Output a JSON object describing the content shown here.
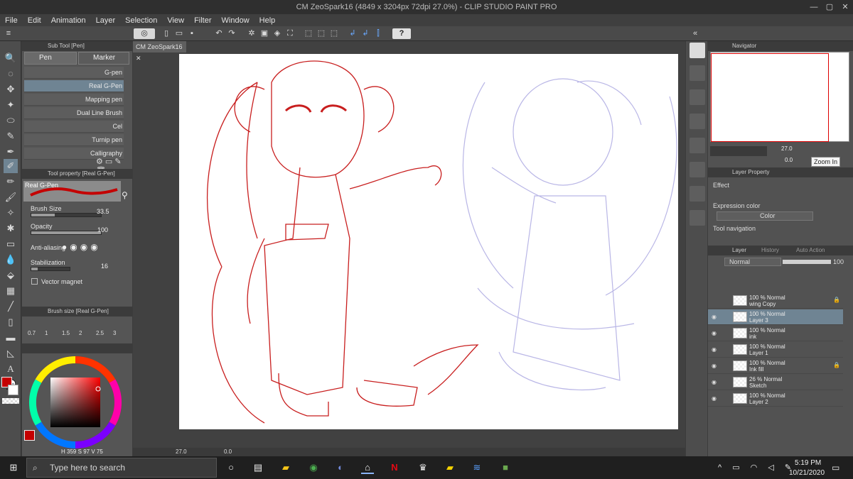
{
  "window": {
    "title": "CM ZeoSpark16 (4849 x 3204px 72dpi 27.0%) - CLIP STUDIO PAINT PRO",
    "min": "—",
    "max": "▢",
    "close": "✕"
  },
  "menu": [
    "File",
    "Edit",
    "Animation",
    "Layer",
    "Selection",
    "View",
    "Filter",
    "Window",
    "Help"
  ],
  "doc_tab": "CM ZeoSpark16",
  "subtool": {
    "header": "Sub Tool [Pen]",
    "tab_pen": "Pen",
    "tab_marker": "Marker",
    "brushes": [
      "G-pen",
      "Real G-Pen",
      "Mapping pen",
      "Dual Line Brush",
      "Cel",
      "Turnip pen",
      "Calligraphy"
    ],
    "selected_index": 1
  },
  "toolprop": {
    "header": "Tool property [Real G-Pen]",
    "brush_name": "Real G-Pen",
    "brush_size_label": "Brush Size",
    "brush_size": "33.5",
    "brush_size_level": 0.34,
    "opacity_label": "Opacity",
    "opacity": "100",
    "opacity_level": 1.0,
    "antialias_label": "Anti-aliasing",
    "stab_label": "Stabilization",
    "stab": "16",
    "stab_level": 0.16,
    "vector_label": "Vector magnet"
  },
  "brushsize": {
    "header": "Brush size [Real G-Pen]",
    "sizes": [
      "0.7",
      "1",
      "1.5",
      "2",
      "2.5",
      "3"
    ]
  },
  "color": {
    "main": "#c40000",
    "sub": "#ffffff",
    "h": "359",
    "s": "97",
    "v": "75",
    "h_label": "H",
    "s_label": "S",
    "v_label": "V"
  },
  "canvas_status": {
    "zoom": "27.0",
    "angle": "0.0"
  },
  "navigator": {
    "header": "Navigator",
    "zoom": "27.0",
    "angle": "0.0",
    "tooltip": "Zoom In"
  },
  "layerprop": {
    "header": "Layer Property",
    "effect_label": "Effect",
    "expr_label": "Expression color",
    "expr_value": "Color",
    "toolnav_label": "Tool navigation"
  },
  "layers_panel": {
    "tab_layer": "Layer",
    "tab_history": "History",
    "tab_auto": "Auto Action",
    "blend": "Normal",
    "opacity": "100",
    "layers": [
      {
        "line1": "100 % Normal",
        "line2": "wing Copy",
        "selected": false,
        "visible": false,
        "locked": true
      },
      {
        "line1": "100 % Normal",
        "line2": "Layer 3",
        "selected": true,
        "visible": true,
        "locked": false
      },
      {
        "line1": "100 % Normal",
        "line2": "ink",
        "selected": false,
        "visible": true,
        "locked": false
      },
      {
        "line1": "100 % Normal",
        "line2": "Layer 1",
        "selected": false,
        "visible": true,
        "locked": false
      },
      {
        "line1": "100 % Normal",
        "line2": "Ink fill",
        "selected": false,
        "visible": true,
        "locked": true
      },
      {
        "line1": "26 % Normal",
        "line2": "Sketch",
        "selected": false,
        "visible": true,
        "locked": false
      },
      {
        "line1": "100 % Normal",
        "line2": "Layer 2",
        "selected": false,
        "visible": true,
        "locked": false
      }
    ]
  },
  "taskbar": {
    "search_placeholder": "Type here to search",
    "time": "5:19 PM",
    "date": "10/21/2020"
  },
  "colors": {
    "ink_red": "#c81e1e",
    "sketch_blue": "#b9b6e6",
    "accent_sel": "#6f8493"
  }
}
